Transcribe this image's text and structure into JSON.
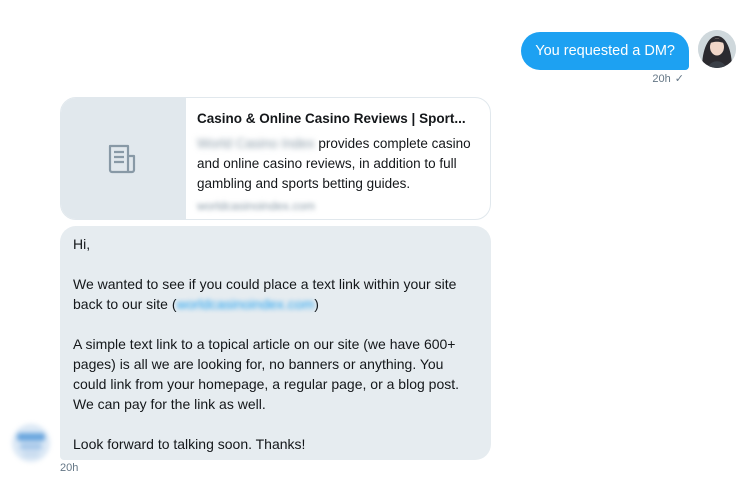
{
  "outgoing": {
    "text": "You requested a DM?",
    "time": "20h",
    "status_icon": "checkmark-icon",
    "accent": "#1da1f2"
  },
  "card": {
    "icon": "document-icon",
    "title": "Casino & Online Casino Reviews | Sport...",
    "desc_blurred": "World Casino Index",
    "desc": "provides complete casino and online casino reviews, in addition to full gambling and sports betting guides.",
    "domain": "worldcasinoindex.com"
  },
  "incoming": {
    "greeting": "Hi,",
    "para1_before": "We wanted to see if you could place a text link within your site back to our site (",
    "para1_link": "worldcasinoindex.com",
    "para1_after": ")",
    "para2": "A simple text link to a topical article on our site (we have 600+ pages) is all we are looking for, no banners or anything. You could link from your homepage, a regular page, or a blog post. We can pay for the link as well.",
    "closing": "Look forward to talking soon. Thanks!",
    "time": "20h",
    "bubble_color": "#e6ecf0"
  }
}
